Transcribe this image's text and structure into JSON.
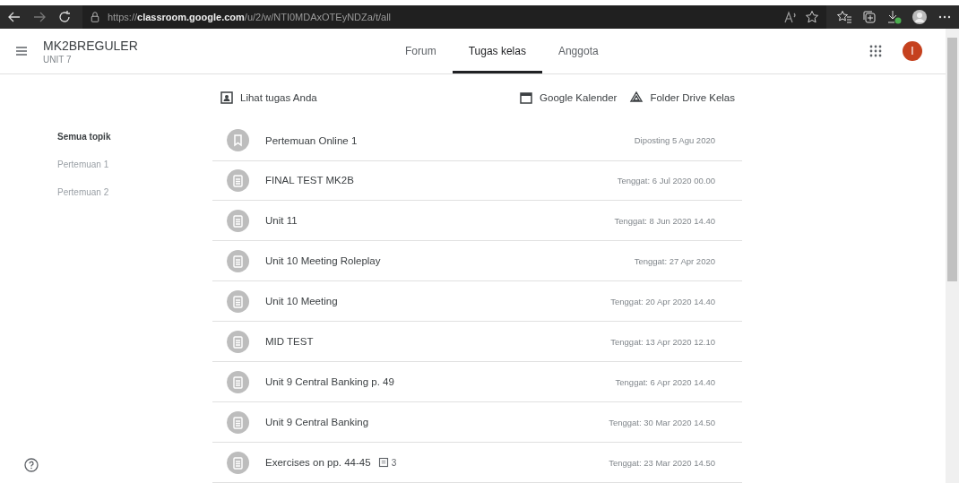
{
  "browser": {
    "url_scheme": "https://",
    "url_host": "classroom.google.com",
    "url_path": "/u/2/w/NTI0MDAxOTEyNDZa/t/all"
  },
  "header": {
    "class_name": "MK2BREGULER",
    "section": "UNIT 7",
    "avatar_letter": "I"
  },
  "tabs": [
    {
      "label": "Forum",
      "selected": false
    },
    {
      "label": "Tugas kelas",
      "selected": true
    },
    {
      "label": "Anggota",
      "selected": false
    }
  ],
  "actions": {
    "your_work": "Lihat tugas Anda",
    "calendar": "Google Kalender",
    "drive": "Folder Drive Kelas"
  },
  "topics": [
    {
      "label": "Semua topik",
      "selected": true
    },
    {
      "label": "Pertemuan 1",
      "selected": false
    },
    {
      "label": "Pertemuan 2",
      "selected": false
    }
  ],
  "items": [
    {
      "kind": "material",
      "title": "Pertemuan Online 1",
      "date": "Diposting 5 Agu 2020"
    },
    {
      "kind": "assignment",
      "title": "FINAL TEST MK2B",
      "date": "Tenggat: 6 Jul 2020 00.00"
    },
    {
      "kind": "assignment",
      "title": "Unit 11",
      "date": "Tenggat: 8 Jun 2020 14.40"
    },
    {
      "kind": "assignment",
      "title": "Unit 10 Meeting Roleplay",
      "date": "Tenggat: 27 Apr 2020"
    },
    {
      "kind": "assignment",
      "title": "Unit 10 Meeting",
      "date": "Tenggat: 20 Apr 2020 14.40"
    },
    {
      "kind": "assignment",
      "title": "MID TEST",
      "date": "Tenggat: 13 Apr 2020 12.10"
    },
    {
      "kind": "assignment",
      "title": "Unit 9 Central Banking p. 49",
      "date": "Tenggat: 6 Apr 2020 14.40"
    },
    {
      "kind": "assignment",
      "title": "Unit 9 Central Banking",
      "date": "Tenggat: 30 Mar 2020 14.50"
    },
    {
      "kind": "assignment",
      "title": "Exercises on pp. 44-45",
      "comments": "3",
      "date": "Tenggat: 23 Mar 2020 14.50"
    }
  ]
}
